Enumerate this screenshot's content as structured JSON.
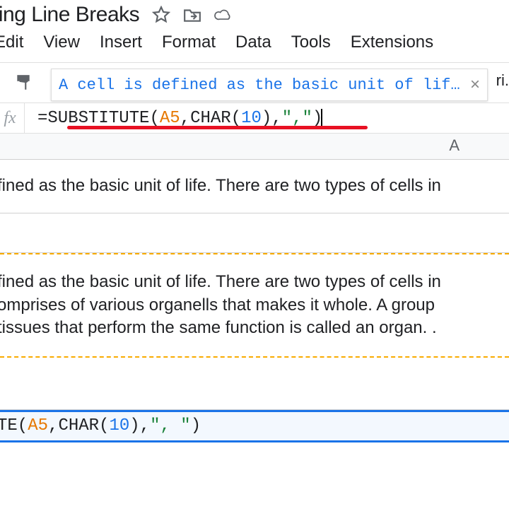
{
  "doc": {
    "title": "ting Line Breaks"
  },
  "menu": {
    "edit": "Edit",
    "view": "View",
    "insert": "Insert",
    "format": "Format",
    "data": "Data",
    "tools": "Tools",
    "extensions": "Extensions"
  },
  "toolbar": {
    "preview_text": "A cell is defined as the basic unit of lif…",
    "close_glyph": "×",
    "ri_fragment": "ri."
  },
  "formula": {
    "fx_label": "fx",
    "eq": "=",
    "fn": "SUBSTITUTE",
    "open": "(",
    "ref": "A5",
    "comma": ",",
    "char_fn": "CHAR",
    "char_open": "(",
    "char_arg": "10",
    "char_close": ")",
    "str_open": "\"",
    "str_body": ", ",
    "str_close": "\"",
    "close": ")"
  },
  "columns": {
    "A": "A"
  },
  "cells": {
    "r1": "fined as the basic unit of life. There are two types of cells in",
    "r3": "fined as the basic unit of life. There are two types of cells in\nomprises of various organells that makes it whole. A group\ntissues that perform the same function is called an organ. .",
    "r5_prefix": "TE(",
    "r5_ref": "A5",
    "r5_c1": ",",
    "r5_char": "CHAR",
    "r5_open": "(",
    "r5_arg": "10",
    "r5_close": ")",
    "r5_c2": ",",
    "r5_q1": "\"",
    "r5_body": ", ",
    "r5_q2": "\"",
    "r5_end": ")"
  }
}
